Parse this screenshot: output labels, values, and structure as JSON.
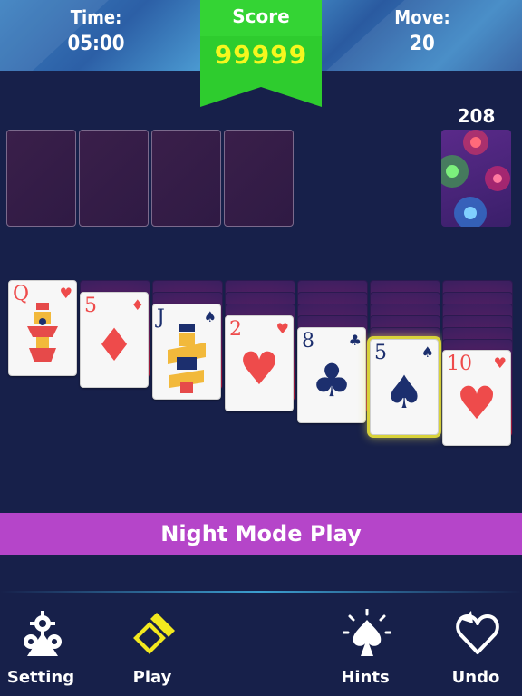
{
  "header": {
    "time_label": "Time:",
    "time_value": "05:00",
    "score_label": "Score",
    "score_value": "99999",
    "move_label": "Move:",
    "move_value": "20"
  },
  "stock": {
    "count": "208"
  },
  "tableau": [
    {
      "rank": "Q",
      "suit": "hearts",
      "face_down": 0
    },
    {
      "rank": "5",
      "suit": "diamonds",
      "face_down": 1
    },
    {
      "rank": "J",
      "suit": "spades",
      "face_down": 2
    },
    {
      "rank": "2",
      "suit": "hearts",
      "face_down": 3
    },
    {
      "rank": "8",
      "suit": "clubs",
      "face_down": 4
    },
    {
      "rank": "5",
      "suit": "spades",
      "face_down": 5,
      "selected": true
    },
    {
      "rank": "10",
      "suit": "hearts",
      "face_down": 6
    }
  ],
  "banner": {
    "text": "Night Mode Play"
  },
  "nav": {
    "setting": "Setting",
    "play": "Play",
    "hints": "Hints",
    "undo": "Undo"
  },
  "colors": {
    "background": "#17204a",
    "banner": "#b545c9",
    "score_ribbon": "#2ecc2e",
    "score_text": "#f5f71e",
    "red_suit": "#ee4b4b",
    "black_suit": "#1c2f6e",
    "play_icon": "#f2e81f"
  }
}
